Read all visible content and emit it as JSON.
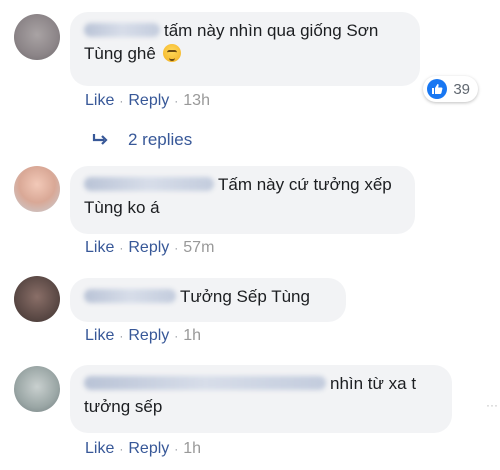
{
  "comments": [
    {
      "text": "tấm này nhìn qua giống Sơn",
      "text2": "Tùng ghê",
      "actions": {
        "like": "Like",
        "reply": "Reply",
        "time": "13h"
      },
      "reaction_count": "39"
    },
    {
      "text": "Tấm này cứ tưởng xếp",
      "text2": "Tùng ko á",
      "actions": {
        "like": "Like",
        "reply": "Reply",
        "time": "57m"
      }
    },
    {
      "text": "Tưởng Sếp Tùng",
      "actions": {
        "like": "Like",
        "reply": "Reply",
        "time": "1h"
      }
    },
    {
      "text": "nhìn từ xa t",
      "text2": "tưởng sếp",
      "actions": {
        "like": "Like",
        "reply": "Reply",
        "time": "1h"
      }
    }
  ],
  "replies_link": "2 replies",
  "colors": {
    "link": "#385898",
    "bubble": "#f2f3f5",
    "like_blue": "#1877f2"
  }
}
